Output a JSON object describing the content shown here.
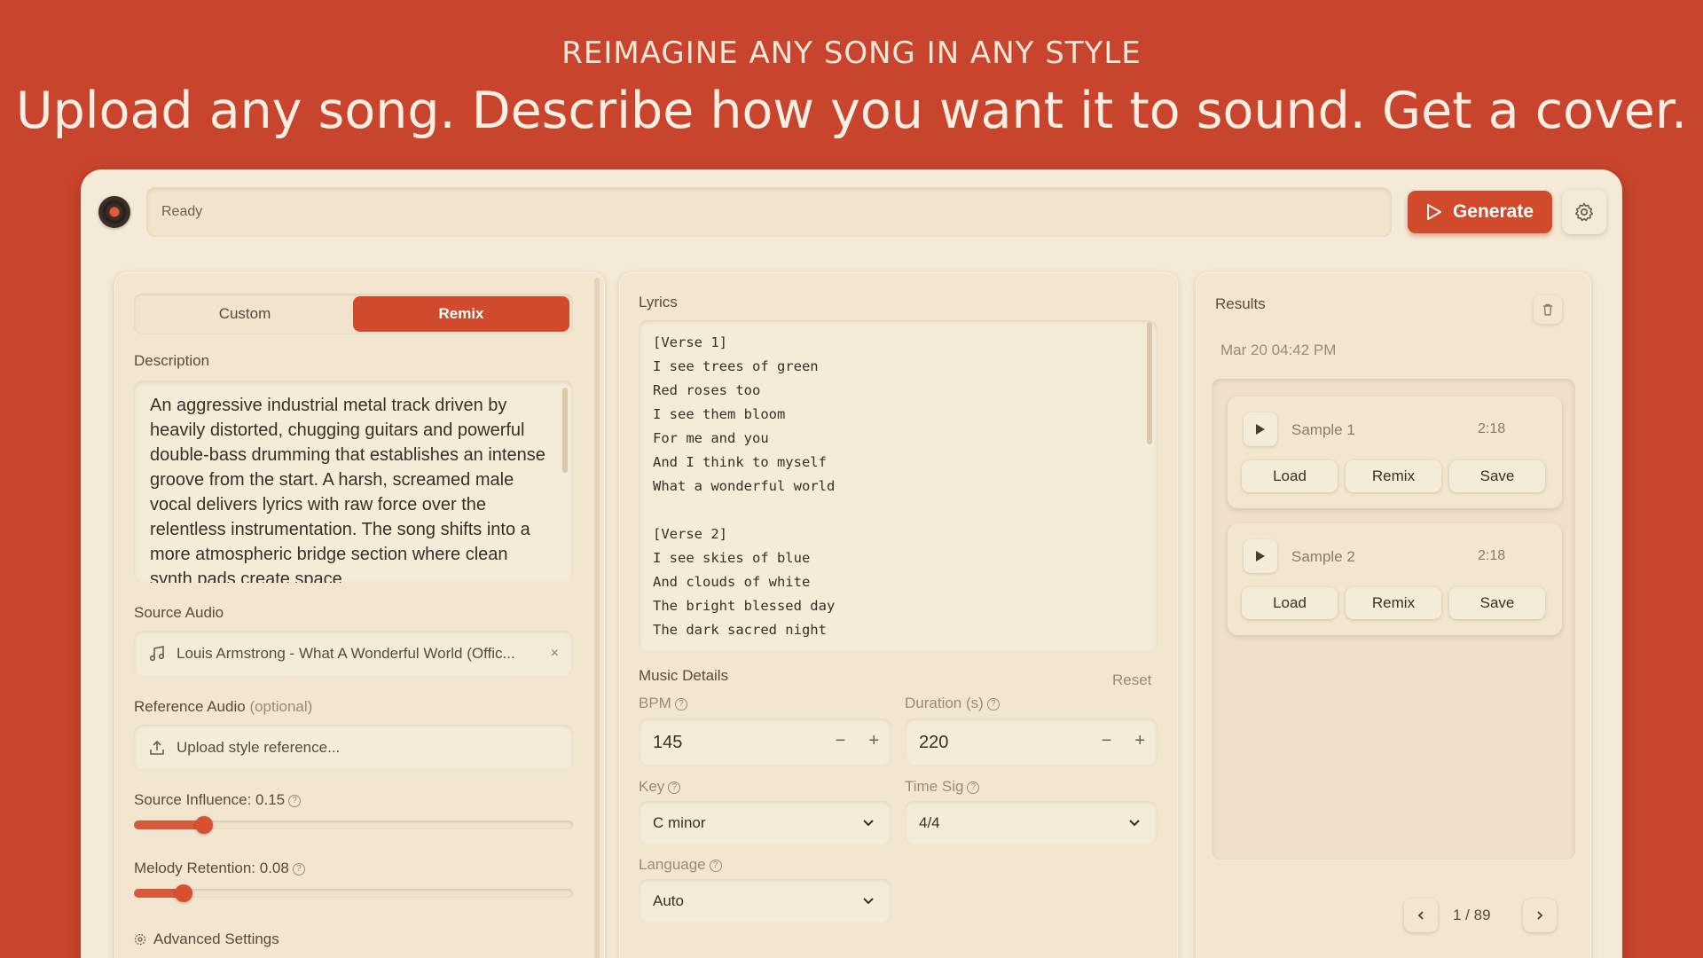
{
  "hero": {
    "subtitle": "REIMAGINE ANY SONG IN ANY STYLE",
    "title": "Upload any song. Describe how you want it to sound. Get a cover."
  },
  "toolbar": {
    "status": "Ready",
    "generate_label": "Generate"
  },
  "left": {
    "tabs": [
      {
        "label": "Custom",
        "active": false
      },
      {
        "label": "Remix",
        "active": true
      }
    ],
    "description_label": "Description",
    "description_text": "An aggressive industrial metal track driven by heavily distorted, chugging guitars and powerful double-bass drumming that establishes an intense groove from the start. A harsh, screamed male vocal delivers lyrics with raw force over the relentless instrumentation. The song shifts into a more atmospheric bridge section where clean synth pads create space",
    "source_audio_label": "Source Audio",
    "source_audio_file": "Louis Armstrong - What A Wonderful World (Offic...",
    "reference_label": "Reference Audio",
    "reference_optional": "(optional)",
    "reference_placeholder": "Upload style reference...",
    "source_influence_label": "Source Influence: 0.15",
    "source_influence_value": 0.15,
    "melody_retention_label": "Melody Retention: 0.08",
    "melody_retention_value": 0.08,
    "advanced_label": "Advanced Settings"
  },
  "middle": {
    "lyrics_label": "Lyrics",
    "lyrics": "[Verse 1]\nI see trees of green\nRed roses too\nI see them bloom\nFor me and you\nAnd I think to myself\nWhat a wonderful world\n\n[Verse 2]\nI see skies of blue\nAnd clouds of white\nThe bright blessed day\nThe dark sacred night",
    "music_details_label": "Music Details",
    "reset_label": "Reset",
    "bpm_label": "BPM",
    "bpm_value": "145",
    "duration_label": "Duration (s)",
    "duration_value": "220",
    "key_label": "Key",
    "key_value": "C minor",
    "time_sig_label": "Time Sig",
    "time_sig_value": "4/4",
    "language_label": "Language",
    "language_value": "Auto"
  },
  "right": {
    "results_label": "Results",
    "timestamp": "Mar 20 04:42 PM",
    "samples": [
      {
        "name": "Sample 1",
        "duration": "2:18"
      },
      {
        "name": "Sample 2",
        "duration": "2:18"
      }
    ],
    "load_label": "Load",
    "remix_label": "Remix",
    "save_label": "Save",
    "pager": "1 / 89"
  },
  "colors": {
    "background": "#c9442c",
    "accent": "#d24a2c",
    "panel": "#f3e6d0"
  }
}
